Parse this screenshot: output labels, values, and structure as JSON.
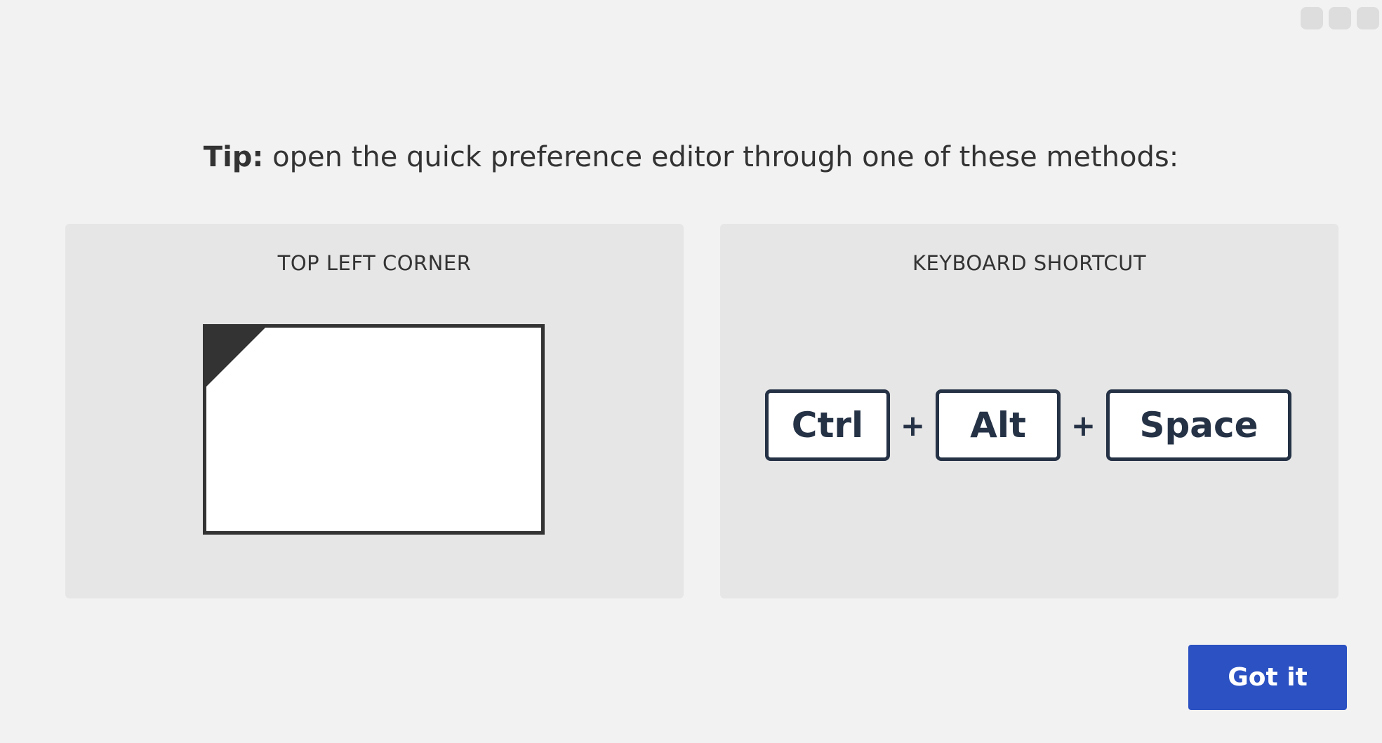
{
  "window_controls": [
    "window-control",
    "window-control",
    "window-control"
  ],
  "tip": {
    "label": "Tip:",
    "text": " open the quick preference editor through one of these methods:"
  },
  "methods": {
    "corner": {
      "title": "TOP LEFT CORNER"
    },
    "shortcut": {
      "title": "KEYBOARD SHORTCUT",
      "keys": [
        "Ctrl",
        "Alt",
        "Space"
      ],
      "separator": "+"
    }
  },
  "actions": {
    "confirm_label": "Got it"
  },
  "colors": {
    "background": "#f2f2f2",
    "panel": "#e6e6e6",
    "key_border": "#253246",
    "button": "#2b51c2"
  }
}
